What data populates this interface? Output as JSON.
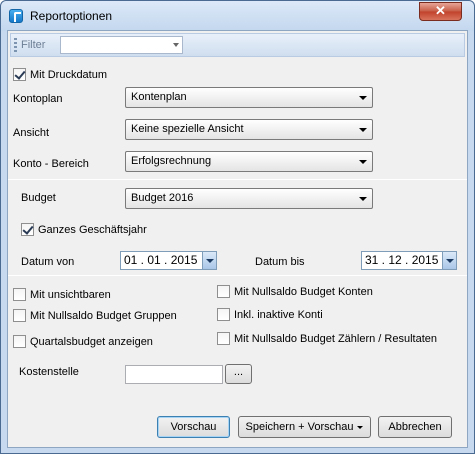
{
  "window": {
    "title": "Reportoptionen",
    "close_glyph": "✕"
  },
  "filter": {
    "label": "Filter",
    "value": ""
  },
  "options": {
    "mit_druckdatum": {
      "label": "Mit Druckdatum",
      "checked": true
    }
  },
  "fields": {
    "kontoplan": {
      "label": "Kontoplan",
      "value": "Kontenplan"
    },
    "ansicht": {
      "label": "Ansicht",
      "value": "Keine spezielle Ansicht"
    },
    "konto_bereich": {
      "label": "Konto - Bereich",
      "value": "Erfolgsrechnung"
    },
    "budget": {
      "label": "Budget",
      "value": "Budget 2016"
    }
  },
  "ganzes_geschaeftsjahr": {
    "label": "Ganzes Geschäftsjahr",
    "checked": true
  },
  "datum_von": {
    "label": "Datum von",
    "value": "01 . 01 . 2015"
  },
  "datum_bis": {
    "label": "Datum bis",
    "value": "31 . 12 . 2015"
  },
  "checkboxes_left": [
    {
      "label": "Mit unsichtbaren",
      "checked": false
    },
    {
      "label": "Mit Nullsaldo Budget Gruppen",
      "checked": false
    },
    {
      "label": "Quartalsbudget anzeigen",
      "checked": false
    }
  ],
  "checkboxes_right": [
    {
      "label": "Mit Nullsaldo Budget Konten",
      "checked": false
    },
    {
      "label": "Inkl. inaktive Konti",
      "checked": false
    },
    {
      "label": "Mit Nullsaldo Budget Zählern / Resultaten",
      "checked": false
    }
  ],
  "kostenstelle": {
    "label": "Kostenstelle",
    "value": "",
    "browse_label": "..."
  },
  "buttons": {
    "vorschau": "Vorschau",
    "speichern_vorschau": "Speichern + Vorschau",
    "abbrechen": "Abbrechen"
  }
}
